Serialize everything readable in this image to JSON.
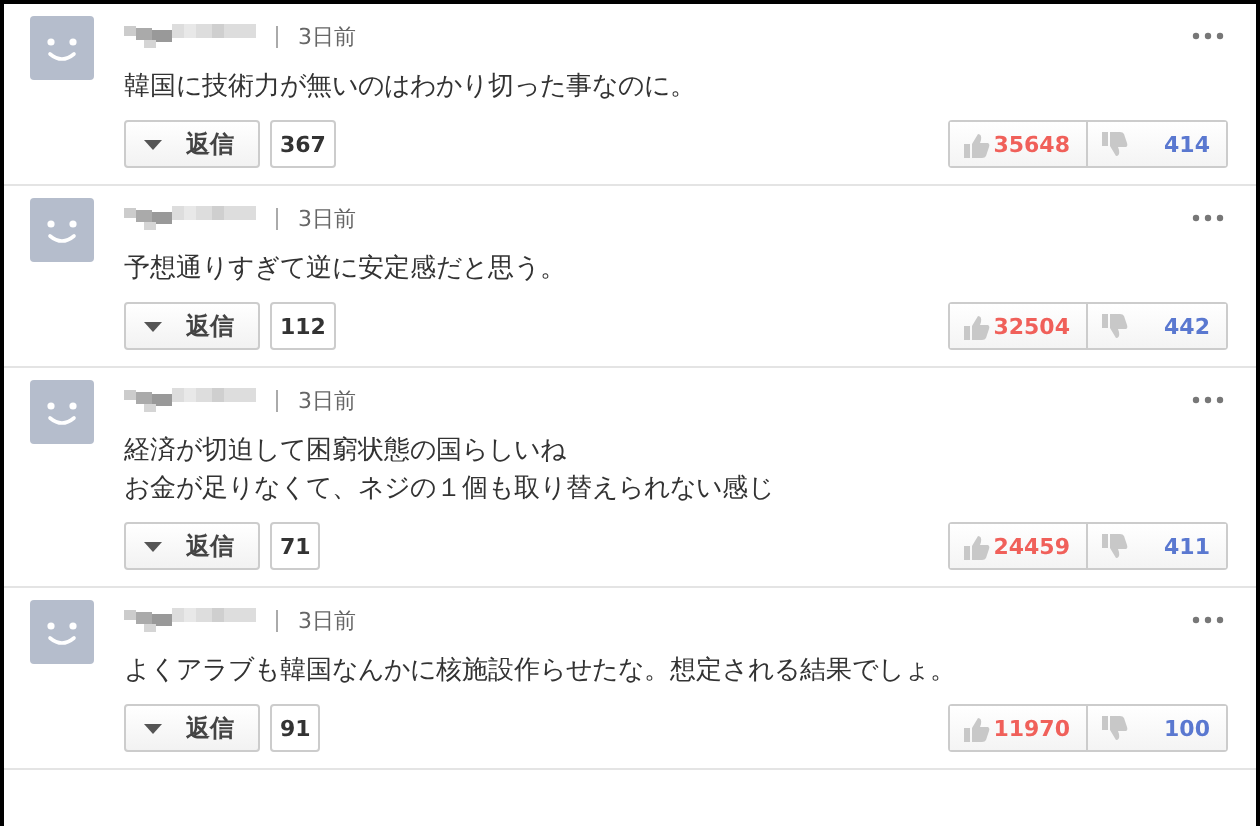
{
  "comments": [
    {
      "time": "3日前",
      "lines": [
        "韓国に技術力が無いのはわかり切った事なのに。"
      ],
      "reply_label": "返信",
      "reply_count": "367",
      "likes": "35648",
      "dislikes": "414"
    },
    {
      "time": "3日前",
      "lines": [
        "予想通りすぎて逆に安定感だと思う。"
      ],
      "reply_label": "返信",
      "reply_count": "112",
      "likes": "32504",
      "dislikes": "442"
    },
    {
      "time": "3日前",
      "lines": [
        "経済が切迫して困窮状態の国らしいね",
        "お金が足りなくて、ネジの１個も取り替えられない感じ"
      ],
      "reply_label": "返信",
      "reply_count": "71",
      "likes": "24459",
      "dislikes": "411"
    },
    {
      "time": "3日前",
      "lines": [
        "よくアラブも韓国なんかに核施設作らせたな。想定される結果でしょ。"
      ],
      "reply_label": "返信",
      "reply_count": "91",
      "likes": "11970",
      "dislikes": "100"
    }
  ]
}
